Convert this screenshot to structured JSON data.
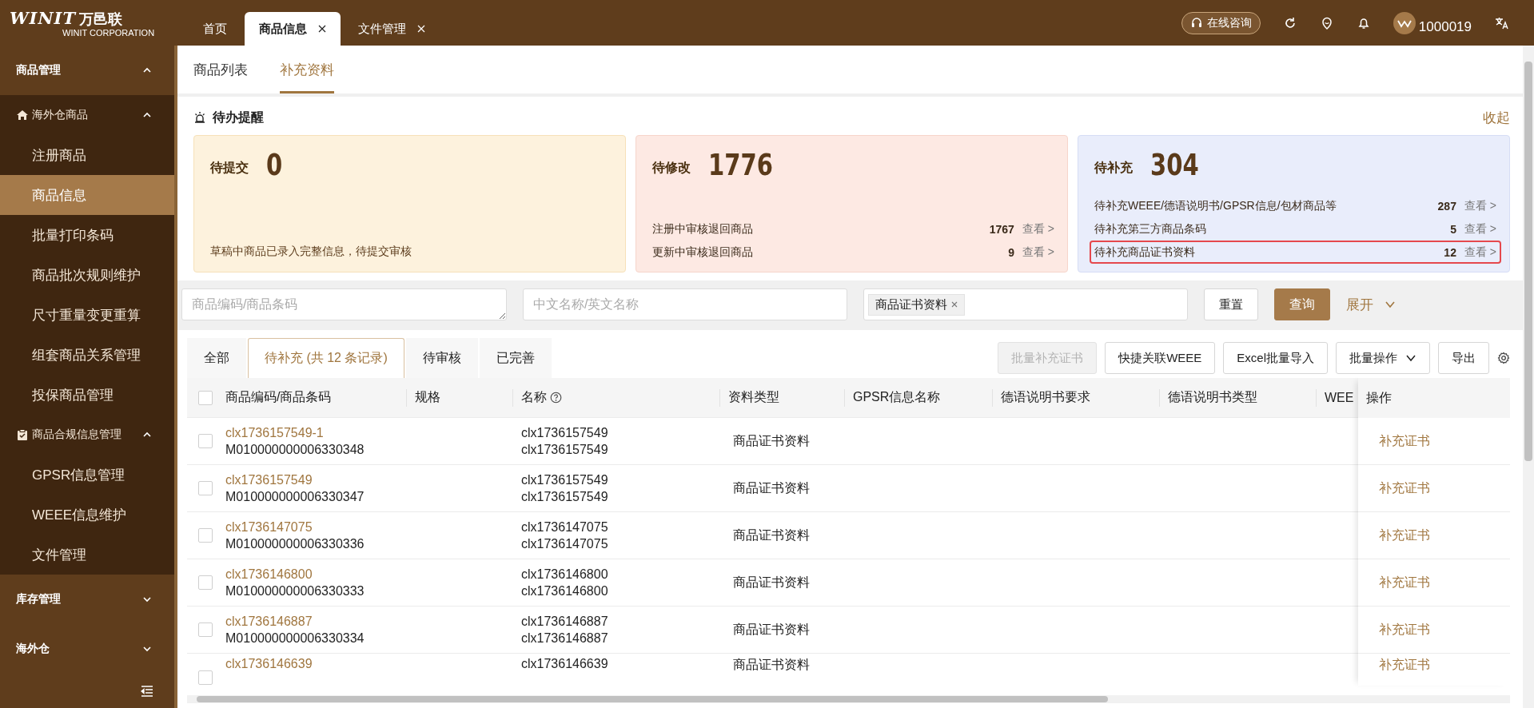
{
  "header": {
    "logo": {
      "mark": "WINIT",
      "brand": "万邑联",
      "sub": "WINIT CORPORATION"
    },
    "tabs": [
      {
        "label": "首页",
        "selected": false,
        "closable": false
      },
      {
        "label": "商品信息",
        "selected": true,
        "closable": true
      },
      {
        "label": "文件管理",
        "selected": false,
        "closable": true
      }
    ],
    "consult": "在线咨询",
    "user": "1000019"
  },
  "sidebar": {
    "groups": [
      {
        "label": "商品管理",
        "expanded": true,
        "children": [
          {
            "label": "海外仓商品",
            "kind": "home",
            "expanded": true,
            "children": [
              {
                "label": "注册商品",
                "selected": false
              },
              {
                "label": "商品信息",
                "selected": true
              },
              {
                "label": "批量打印条码",
                "selected": false
              },
              {
                "label": "商品批次规则维护",
                "selected": false
              },
              {
                "label": "尺寸重量变更重算",
                "selected": false
              },
              {
                "label": "组套商品关系管理",
                "selected": false
              },
              {
                "label": "投保商品管理",
                "selected": false
              }
            ]
          },
          {
            "label": "商品合规信息管理",
            "kind": "clipboard",
            "expanded": true,
            "children": [
              {
                "label": "GPSR信息管理",
                "selected": false
              },
              {
                "label": "WEEE信息维护",
                "selected": false
              },
              {
                "label": "文件管理",
                "selected": false
              }
            ]
          }
        ]
      },
      {
        "label": "库存管理",
        "expanded": false
      },
      {
        "label": "海外仓",
        "expanded": false
      }
    ]
  },
  "subtabs": [
    {
      "label": "商品列表",
      "selected": false
    },
    {
      "label": "补充资料",
      "selected": true
    }
  ],
  "todo": {
    "title": "待办提醒",
    "collapse": "收起",
    "cards": [
      {
        "kind": "submit",
        "label": "待提交",
        "count": "0",
        "note": "草稿中商品已录入完整信息，待提交审核"
      },
      {
        "kind": "modify",
        "label": "待修改",
        "count": "1776",
        "rows": [
          {
            "label": "注册中审核退回商品",
            "count": "1767",
            "link": "查看 >",
            "highlighted": false
          },
          {
            "label": "更新中审核退回商品",
            "count": "9",
            "link": "查看 >",
            "highlighted": false
          }
        ]
      },
      {
        "kind": "supplement",
        "label": "待补充",
        "count": "304",
        "rows": [
          {
            "label": "待补充WEEE/德语说明书/GPSR信息/包材商品等",
            "count": "287",
            "link": "查看 >",
            "highlighted": false
          },
          {
            "label": "待补充第三方商品条码",
            "count": "5",
            "link": "查看 >",
            "highlighted": false
          },
          {
            "label": "待补充商品证书资料",
            "count": "12",
            "link": "查看 >",
            "highlighted": true
          }
        ]
      }
    ]
  },
  "filters": [
    {
      "kind": "textarea",
      "placeholder": "商品编码/商品条码"
    },
    {
      "kind": "input",
      "placeholder": "中文名称/英文名称"
    },
    {
      "kind": "tags",
      "tags": [
        "商品证书资料"
      ]
    }
  ],
  "filter_buttons": {
    "reset": "重置",
    "query": "查询",
    "expand": "展开"
  },
  "list_tabs": [
    {
      "label": "全部",
      "selected": false
    },
    {
      "label": "待补充 (共 12 条记录)",
      "selected": true
    },
    {
      "label": "待审核",
      "selected": false
    },
    {
      "label": "已完善",
      "selected": false
    }
  ],
  "toolbar": [
    {
      "label": "批量补充证书",
      "disabled": true,
      "dropdown": false
    },
    {
      "label": "快捷关联WEEE",
      "disabled": false,
      "dropdown": false
    },
    {
      "label": "Excel批量导入",
      "disabled": false,
      "dropdown": false
    },
    {
      "label": "批量操作",
      "disabled": false,
      "dropdown": true
    },
    {
      "label": "导出",
      "disabled": false,
      "dropdown": false
    }
  ],
  "table": {
    "all_checked": false,
    "columns": [
      {
        "label": "商品编码/商品条码",
        "help": false
      },
      {
        "label": "规格",
        "help": false
      },
      {
        "label": "名称",
        "help": true
      },
      {
        "label": "资料类型",
        "help": false
      },
      {
        "label": "GPSR信息名称",
        "help": false
      },
      {
        "label": "德语说明书要求",
        "help": false
      },
      {
        "label": "德语说明书类型",
        "help": false
      },
      {
        "label": "WEE",
        "help": false
      }
    ],
    "action_column": "操作",
    "rows": [
      {
        "code": "clx1736157549-1",
        "barcode": "M010000000006330348",
        "name_1": "clx1736157549",
        "name_2": "clx1736157549",
        "type": "商品证书资料",
        "action": "补充证书",
        "checked": false
      },
      {
        "code": "clx1736157549",
        "barcode": "M010000000006330347",
        "name_1": "clx1736157549",
        "name_2": "clx1736157549",
        "type": "商品证书资料",
        "action": "补充证书",
        "checked": false
      },
      {
        "code": "clx1736147075",
        "barcode": "M010000000006330336",
        "name_1": "clx1736147075",
        "name_2": "clx1736147075",
        "type": "商品证书资料",
        "action": "补充证书",
        "checked": false
      },
      {
        "code": "clx1736146800",
        "barcode": "M010000000006330333",
        "name_1": "clx1736146800",
        "name_2": "clx1736146800",
        "type": "商品证书资料",
        "action": "补充证书",
        "checked": false
      },
      {
        "code": "clx1736146887",
        "barcode": "M010000000006330334",
        "name_1": "clx1736146887",
        "name_2": "clx1736146887",
        "type": "商品证书资料",
        "action": "补充证书",
        "checked": false
      },
      {
        "code": "clx1736146639",
        "name_1": "clx1736146639",
        "type": "商品证书资料",
        "action": "补充证书",
        "checked": false
      }
    ]
  }
}
